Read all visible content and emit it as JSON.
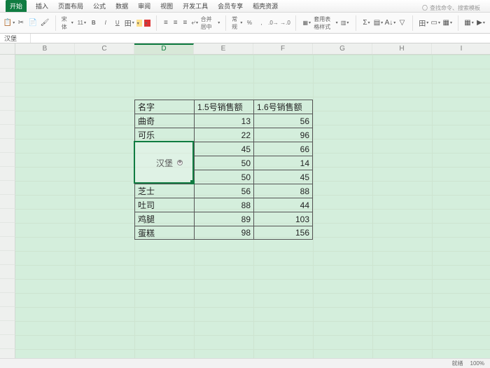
{
  "tabs": {
    "items": [
      "开始",
      "插入",
      "页面布局",
      "公式",
      "数据",
      "审阅",
      "视图",
      "开发工具",
      "会员专享",
      "稻壳资源"
    ],
    "active_index": 0,
    "search_hint": "查找命令、搜索模板"
  },
  "ribbon": {
    "paste": "粘",
    "cut": "✂",
    "copy": "复",
    "font_family": "宋体",
    "font_size": "11",
    "bold": "B",
    "italic": "I",
    "underline": "U",
    "align": "≡",
    "wrap": "自动换行",
    "merge": "合并居中",
    "format": "常规",
    "pct": "%",
    "comma": ",",
    "cond": "条件格式",
    "table": "套用表格样式",
    "styles": "单元格样式",
    "sum": "Σ",
    "fill": "▦",
    "sort": "排",
    "filter": "筛",
    "insert_cells": "田",
    "delete_cells": "删",
    "format_cells": "格式",
    "freeze": "冻结窗格",
    "macros": "宏"
  },
  "formula_bar": {
    "name_box": "汉堡",
    "value": ""
  },
  "columns": [
    "B",
    "C",
    "D",
    "E",
    "F",
    "G",
    "H",
    "I"
  ],
  "active_col_index": 2,
  "table": {
    "header": {
      "d": "名字",
      "e": "1.5号销售额",
      "f": "1.6号销售额"
    },
    "rows": [
      {
        "d": "曲奇",
        "e": "13",
        "f": "56"
      },
      {
        "d": "可乐",
        "e": "22",
        "f": "96"
      },
      {
        "d": "",
        "e": "45",
        "f": "66"
      },
      {
        "d": "汉堡",
        "e": "50",
        "f": "14"
      },
      {
        "d": "",
        "e": "50",
        "f": "45"
      },
      {
        "d": "芝士",
        "e": "56",
        "f": "88"
      },
      {
        "d": "吐司",
        "e": "88",
        "f": "44"
      },
      {
        "d": "鸡腿",
        "e": "89",
        "f": "103"
      },
      {
        "d": "蛋糕",
        "e": "98",
        "f": "156"
      }
    ],
    "merged_d": "汉堡"
  },
  "chart_data": {
    "type": "table",
    "title": "",
    "columns": [
      "名字",
      "1.5号销售额",
      "1.6号销售额"
    ],
    "rows": [
      [
        "曲奇",
        13,
        56
      ],
      [
        "可乐",
        22,
        96
      ],
      [
        "汉堡",
        45,
        66
      ],
      [
        "汉堡",
        50,
        14
      ],
      [
        "汉堡",
        50,
        45
      ],
      [
        "芝士",
        56,
        88
      ],
      [
        "吐司",
        88,
        44
      ],
      [
        "鸡腿",
        89,
        103
      ],
      [
        "蛋糕",
        98,
        156
      ]
    ]
  },
  "status": {
    "left": "",
    "zoom": "100%",
    "ready": "就绪"
  }
}
